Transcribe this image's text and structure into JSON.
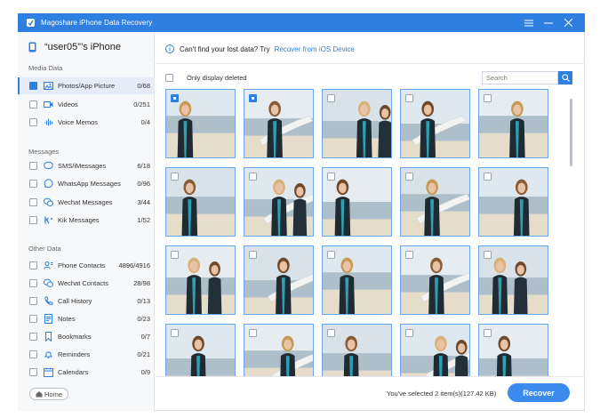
{
  "window": {
    "title": "Magoshare iPhone Data Recovery",
    "accent": "#2f7fe0",
    "icons": [
      "menu-icon",
      "minimize-icon",
      "close-icon"
    ]
  },
  "device": {
    "name": "“user05”’s iPhone"
  },
  "sidebar": {
    "media_title": "Media Data",
    "media": [
      {
        "label": "Photos/App Picture",
        "count": "0/68",
        "icon": "photo-icon",
        "active": true
      },
      {
        "label": "Videos",
        "count": "0/251",
        "icon": "video-icon"
      },
      {
        "label": "Voice Memos",
        "count": "0/4",
        "icon": "voice-memo-icon"
      }
    ],
    "messages_title": "Messages",
    "messages": [
      {
        "label": "SMS/iMessages",
        "count": "6/18",
        "icon": "chat-bubble-icon"
      },
      {
        "label": "WhatsApp Messages",
        "count": "0/96",
        "icon": "whatsapp-icon"
      },
      {
        "label": "Wechat Messages",
        "count": "3/44",
        "icon": "wechat-icon"
      },
      {
        "label": "Kik Messages",
        "count": "1/52",
        "icon": "kik-icon"
      }
    ],
    "other_title": "Other Data",
    "other": [
      {
        "label": "Phone Contacts",
        "count": "4896/4916",
        "icon": "contacts-icon"
      },
      {
        "label": "Wechat Contacts",
        "count": "28/98",
        "icon": "wechat-contacts-icon"
      },
      {
        "label": "Call History",
        "count": "0/13",
        "icon": "phone-icon"
      },
      {
        "label": "Notes",
        "count": "0/23",
        "icon": "notes-icon"
      },
      {
        "label": "Bookmarks",
        "count": "0/7",
        "icon": "bookmark-icon"
      },
      {
        "label": "Reminders",
        "count": "0/21",
        "icon": "bell-icon"
      },
      {
        "label": "Calendars",
        "count": "0/9",
        "icon": "calendar-icon"
      }
    ],
    "home_label": "Home"
  },
  "hint": {
    "text": "Can't find your lost data? Try",
    "link": "Recover from iOS Device"
  },
  "filter": {
    "label": "Only display deleted",
    "search_placeholder": "Search"
  },
  "photos": [
    {
      "checked": true,
      "scene": "two-surfers"
    },
    {
      "checked": true,
      "scene": "two-surfers"
    },
    {
      "checked": false,
      "scene": "surfer-wetsuit"
    },
    {
      "checked": false,
      "scene": "surfer-walking"
    },
    {
      "checked": false,
      "scene": "surfer-board-up"
    },
    {
      "checked": false,
      "scene": "girl-closeup"
    },
    {
      "checked": false,
      "scene": "girl-smile"
    },
    {
      "checked": false,
      "scene": "friends-hug"
    },
    {
      "checked": false,
      "scene": "girl-hair"
    },
    {
      "checked": false,
      "scene": "girl-board-shoulder"
    },
    {
      "checked": false,
      "scene": "girl-portrait"
    },
    {
      "checked": false,
      "scene": "selfie-two"
    },
    {
      "checked": false,
      "scene": "friends-pier"
    },
    {
      "checked": false,
      "scene": "jump"
    },
    {
      "checked": false,
      "scene": "two-girls-laugh"
    },
    {
      "checked": false,
      "scene": "girl-side"
    },
    {
      "checked": false,
      "scene": "girl-blonde"
    },
    {
      "checked": false,
      "scene": "sitting-rocks"
    },
    {
      "checked": false,
      "scene": "two-walking"
    },
    {
      "checked": false,
      "scene": "group-beach"
    }
  ],
  "footer": {
    "selected_text": "You've selected 2 item(s)(127.42 KB)",
    "recover_label": "Recover"
  }
}
